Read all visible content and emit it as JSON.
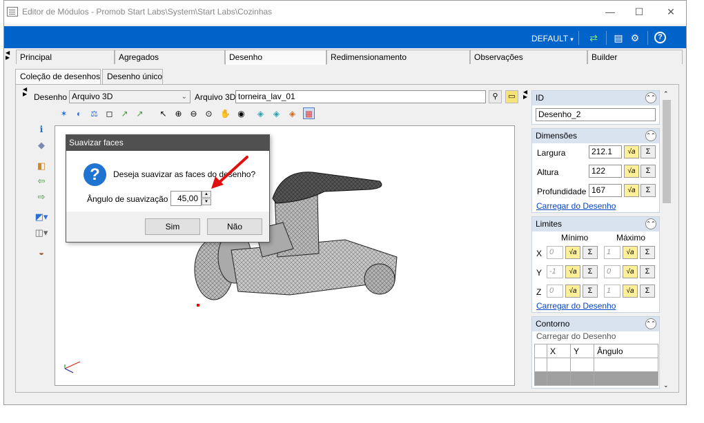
{
  "window": {
    "title": "Editor de Módulos - Promob Start Labs\\System\\Start Labs\\Cozinhas",
    "minimize": "—",
    "maximize": "☐",
    "close": "✕"
  },
  "toolbar": {
    "profile": "DEFAULT",
    "profile_arrow": "▾",
    "refresh_icon": "⇄",
    "list_icon": "▤",
    "settings_icon": "⚙",
    "help_icon": "?",
    "accent_color": "#0063c9"
  },
  "main_tabs": [
    {
      "label": "Principal"
    },
    {
      "label": "Agregados"
    },
    {
      "label": "Desenho",
      "active": true
    },
    {
      "label": "Redimensionamento"
    },
    {
      "label": "Observações"
    },
    {
      "label": "Builder"
    }
  ],
  "sub_tabs": [
    {
      "label": "Coleção de desenhos",
      "active": true
    },
    {
      "label": "Desenho único"
    }
  ],
  "drawing": {
    "desenho_label": "Desenho",
    "desenho_value": "Arquivo 3D",
    "arquivo_label": "Arquivo 3D",
    "arquivo_value": "torneira_lav_01",
    "browse_icon": "binoculars-icon",
    "folder_icon": "folder-icon"
  },
  "dialog": {
    "title": "Suavizar faces",
    "question": "Deseja suavizar as faces do desenho?",
    "angle_label": "Ângulo de suavização",
    "angle_value": "45,00",
    "yes": "Sim",
    "no": "Não"
  },
  "right": {
    "id": {
      "header": "ID",
      "value": "Desenho_2"
    },
    "dimensoes": {
      "header": "Dimensões",
      "rows": [
        {
          "label": "Largura",
          "value": "212.1"
        },
        {
          "label": "Altura",
          "value": "122"
        },
        {
          "label": "Profundidade",
          "value": "167"
        }
      ],
      "link": "Carregar do Desenho"
    },
    "limites": {
      "header": "Limites",
      "min_label": "Mínimo",
      "max_label": "Máximo",
      "rows": [
        {
          "axis": "X",
          "min": "0",
          "max": "1"
        },
        {
          "axis": "Y",
          "min": "-1",
          "max": "0"
        },
        {
          "axis": "Z",
          "min": "0",
          "max": "1"
        }
      ],
      "link": "Carregar do Desenho"
    },
    "contorno": {
      "header": "Contorno",
      "subtitle": "Carregar do Desenho",
      "columns": [
        "X",
        "Y",
        "Ângulo"
      ]
    },
    "sigma": "Σ",
    "sqrt": "√a"
  }
}
